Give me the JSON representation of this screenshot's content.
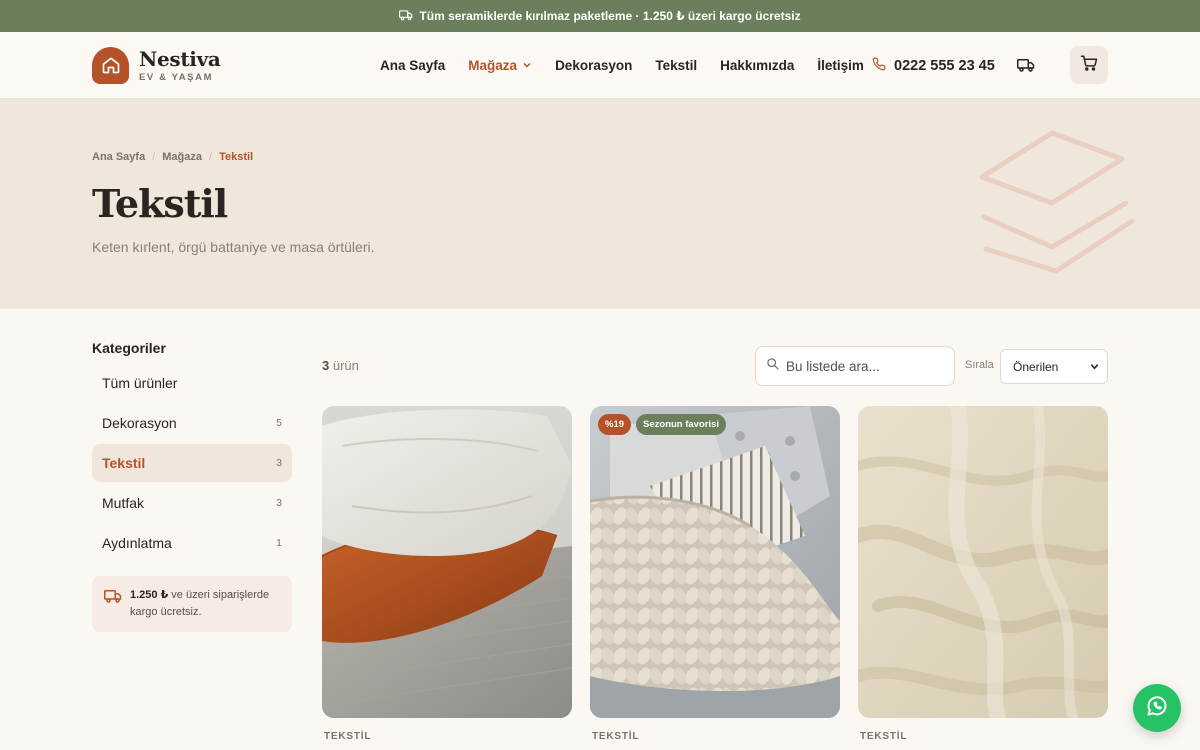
{
  "announcement": {
    "text": "Tüm seramiklerde kırılmaz paketleme · 1.250 ₺ üzeri kargo ücretsiz",
    "icon": "truck-icon"
  },
  "brand": {
    "name": "Nestiva",
    "tagline": "EV & YAŞAM",
    "color": "#b4532a"
  },
  "nav": {
    "items": [
      {
        "label": "Ana Sayfa",
        "active": false
      },
      {
        "label": "Mağaza",
        "active": true,
        "dropdown": true
      },
      {
        "label": "Dekorasyon",
        "active": false
      },
      {
        "label": "Tekstil",
        "active": false
      },
      {
        "label": "Hakkımızda",
        "active": false
      },
      {
        "label": "İletişim",
        "active": false
      }
    ],
    "phone": "0222 555 23 45"
  },
  "breadcrumb": [
    "Ana Sayfa",
    "Mağaza",
    "Tekstil"
  ],
  "hero": {
    "title": "Tekstil",
    "description": "Keten kırlent, örgü battaniye ve masa örtüleri."
  },
  "sidebar": {
    "title": "Kategoriler",
    "items": [
      {
        "label": "Tüm ürünler",
        "count": ""
      },
      {
        "label": "Dekorasyon",
        "count": "5"
      },
      {
        "label": "Tekstil",
        "count": "3",
        "active": true
      },
      {
        "label": "Mutfak",
        "count": "3"
      },
      {
        "label": "Aydınlatma",
        "count": "1"
      }
    ],
    "shipping_amount": "1.250 ₺",
    "shipping_rest": " ve üzeri siparişlerde kargo ücretsiz."
  },
  "toolbar": {
    "count_number": "3",
    "count_label": " ürün",
    "search_placeholder": "Bu listede ara...",
    "sort_label": "Sırala",
    "sort_value": "Önerilen"
  },
  "products": [
    {
      "category": "TEKSTİL",
      "badges": []
    },
    {
      "category": "TEKSTİL",
      "badges": [
        {
          "label": "%19",
          "kind": "discount"
        },
        {
          "label": "Sezonun favorisi",
          "kind": "feature"
        }
      ]
    },
    {
      "category": "TEKSTİL",
      "badges": []
    }
  ],
  "colors": {
    "accent": "#b4532a",
    "green": "#6b7f5c",
    "hero_bg": "#f0e7dc",
    "whatsapp": "#25c366"
  }
}
